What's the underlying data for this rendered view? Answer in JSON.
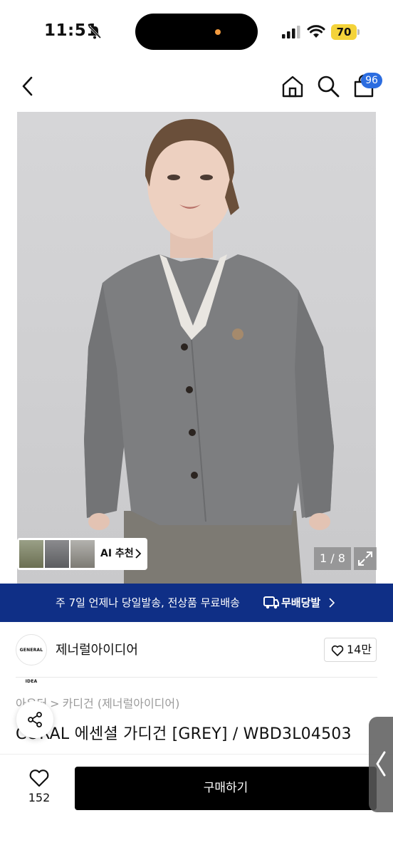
{
  "status_bar": {
    "time": "11:51",
    "battery": "70"
  },
  "header": {
    "cart_count": "96"
  },
  "gallery": {
    "ai_recommend_label": "AI 추천",
    "pager": "1 / 8"
  },
  "banner": {
    "text": "주 7일 언제나 당일발송, 전상품 무료배송",
    "brand": "무배당발"
  },
  "brand": {
    "logo_text": "GENERAL IDEA",
    "name": "제너럴아이디어",
    "likes": "14만"
  },
  "breadcrumb": [
    "아우터",
    "카디건 (제너럴아이디어)"
  ],
  "product": {
    "title": "CORAL 에센셜 가디건 [GREY] / WBD3L04503"
  },
  "bottom_bar": {
    "wish_count": "152",
    "buy_label": "구매하기"
  },
  "colors": {
    "banner_bg": "#0f2f86",
    "badge": "#2c6de0",
    "buy_bg": "#000000",
    "battery": "#f4d33a"
  }
}
